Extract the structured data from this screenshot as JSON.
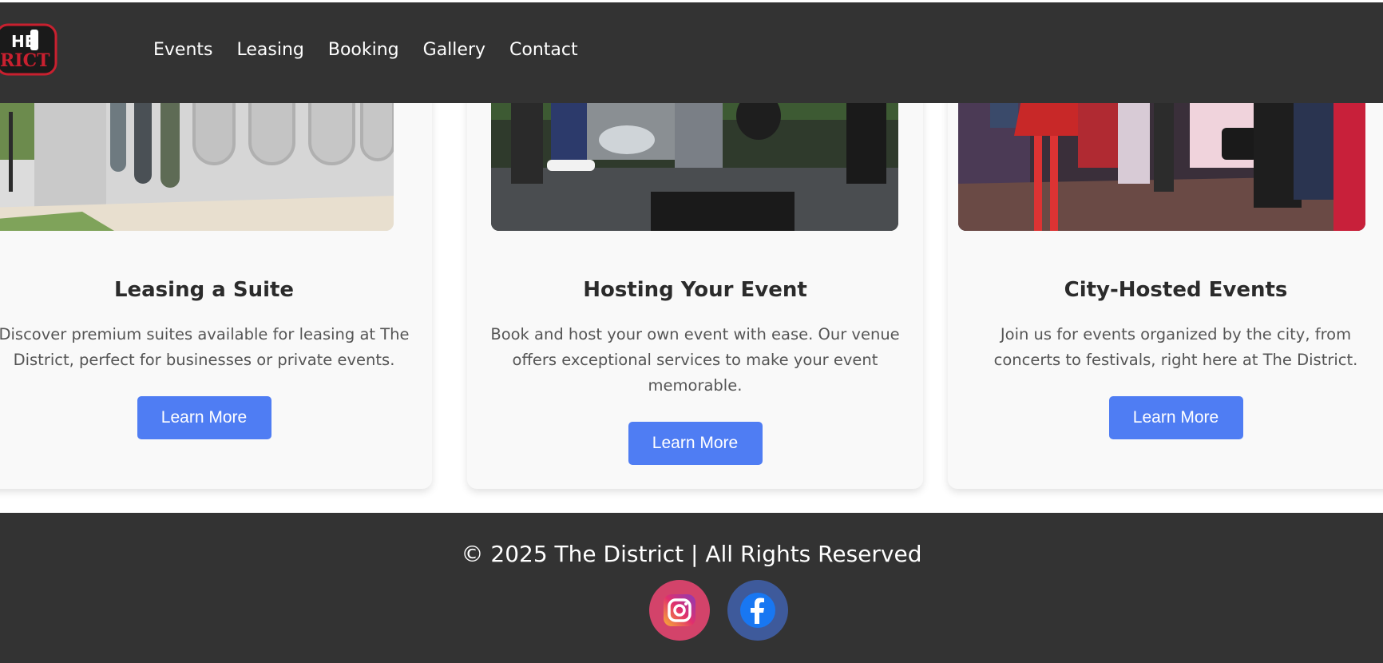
{
  "header": {
    "logo_text": "THE DISTRICT",
    "nav": [
      "Events",
      "Leasing",
      "Booking",
      "Gallery",
      "Contact"
    ]
  },
  "cards": [
    {
      "title": "Leasing a Suite",
      "description": "Discover premium suites available for leasing at The District, perfect for businesses or private events.",
      "button": "Learn More"
    },
    {
      "title": "Hosting Your Event",
      "description": "Book and host your own event with ease. Our venue offers exceptional services to make your event memorable.",
      "button": "Learn More"
    },
    {
      "title": "City-Hosted Events",
      "description": "Join us for events organized by the city, from concerts to festivals, right here at The District.",
      "button": "Learn More"
    }
  ],
  "footer": {
    "copyright": "© 2025 The District | All Rights Reserved",
    "social": [
      {
        "icon": "instagram-icon",
        "color": "#d3436a"
      },
      {
        "icon": "facebook-icon",
        "color": "#3e5a9b"
      }
    ]
  },
  "colors": {
    "header_bg": "#333333",
    "button": "#4f7df3",
    "card_bg": "#f9f9f9",
    "logo_red": "#c8202f"
  }
}
